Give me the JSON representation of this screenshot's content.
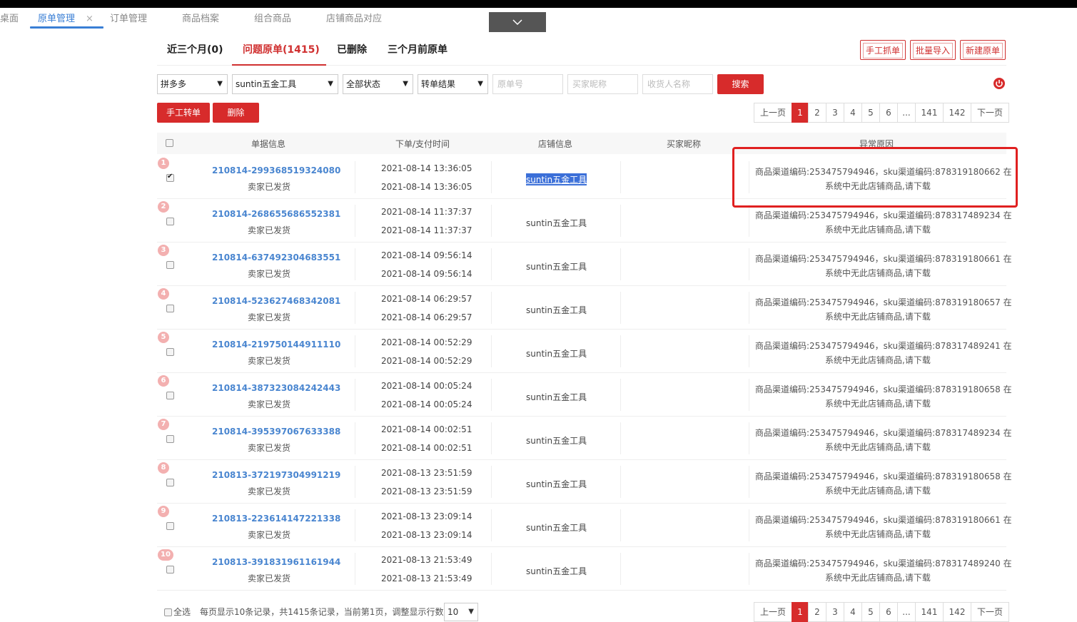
{
  "nav": {
    "tabs": [
      {
        "label": "桌面",
        "active": false
      },
      {
        "label": "原单管理",
        "active": true
      },
      {
        "label": "订单管理",
        "active": false
      },
      {
        "label": "商品档案",
        "active": false
      },
      {
        "label": "组合商品",
        "active": false
      },
      {
        "label": "店铺商品对应",
        "active": false
      }
    ],
    "close_icon": "×"
  },
  "subtabs": [
    "近三个月(0)",
    "问题原单(1415)",
    "已删除",
    "三个月前原单"
  ],
  "actions": {
    "manual_grab": "手工抓单",
    "batch_import": "批量导入",
    "new_order": "新建原单"
  },
  "filters": {
    "platform": "拼多多",
    "shop": "suntin五金工具",
    "status": "全部状态",
    "convert_result": "转单结果",
    "order_no_placeholder": "原单号",
    "buyer_nick_placeholder": "买家昵称",
    "receiver_placeholder": "收货人名称",
    "search_label": "搜索"
  },
  "bulk": {
    "manual_convert": "手工转单",
    "delete": "删除"
  },
  "pagination": {
    "prev": "上一页",
    "pages": [
      "1",
      "2",
      "3",
      "4",
      "5",
      "6",
      "...",
      "141",
      "142"
    ],
    "current": "1",
    "next": "下一页"
  },
  "table": {
    "headers": [
      "单据信息",
      "下单/支付时间",
      "店铺信息",
      "买家昵称",
      "异常原因"
    ],
    "rows": [
      {
        "index": "1",
        "checked": true,
        "order_no": "210814-299368519324080",
        "status": "卖家已发货",
        "order_time": "2021-08-14 13:36:05",
        "pay_time": "2021-08-14 13:36:05",
        "shop": "suntin五金工具",
        "buyer": "",
        "reason_line1": "商品渠道编码:253475794946，sku渠道编码:878319180662 在",
        "reason_line2": "系统中无此店铺商品,请下载"
      },
      {
        "index": "2",
        "checked": false,
        "order_no": "210814-268655686552381",
        "status": "卖家已发货",
        "order_time": "2021-08-14 11:37:37",
        "pay_time": "2021-08-14 11:37:37",
        "shop": "suntin五金工具",
        "buyer": "",
        "reason_line1": "商品渠道编码:253475794946，sku渠道编码:878317489234 在",
        "reason_line2": "系统中无此店铺商品,请下载"
      },
      {
        "index": "3",
        "checked": false,
        "order_no": "210814-637492304683551",
        "status": "卖家已发货",
        "order_time": "2021-08-14 09:56:14",
        "pay_time": "2021-08-14 09:56:14",
        "shop": "suntin五金工具",
        "buyer": "",
        "reason_line1": "商品渠道编码:253475794946，sku渠道编码:878319180661 在",
        "reason_line2": "系统中无此店铺商品,请下载"
      },
      {
        "index": "4",
        "checked": false,
        "order_no": "210814-523627468342081",
        "status": "卖家已发货",
        "order_time": "2021-08-14 06:29:57",
        "pay_time": "2021-08-14 06:29:57",
        "shop": "suntin五金工具",
        "buyer": "",
        "reason_line1": "商品渠道编码:253475794946，sku渠道编码:878319180657 在",
        "reason_line2": "系统中无此店铺商品,请下载"
      },
      {
        "index": "5",
        "checked": false,
        "order_no": "210814-219750144911110",
        "status": "卖家已发货",
        "order_time": "2021-08-14 00:52:29",
        "pay_time": "2021-08-14 00:52:29",
        "shop": "suntin五金工具",
        "buyer": "",
        "reason_line1": "商品渠道编码:253475794946，sku渠道编码:878317489241 在",
        "reason_line2": "系统中无此店铺商品,请下载"
      },
      {
        "index": "6",
        "checked": false,
        "order_no": "210814-387323084242443",
        "status": "卖家已发货",
        "order_time": "2021-08-14 00:05:24",
        "pay_time": "2021-08-14 00:05:24",
        "shop": "suntin五金工具",
        "buyer": "",
        "reason_line1": "商品渠道编码:253475794946，sku渠道编码:878319180658 在",
        "reason_line2": "系统中无此店铺商品,请下载"
      },
      {
        "index": "7",
        "checked": false,
        "order_no": "210814-395397067633388",
        "status": "卖家已发货",
        "order_time": "2021-08-14 00:02:51",
        "pay_time": "2021-08-14 00:02:51",
        "shop": "suntin五金工具",
        "buyer": "",
        "reason_line1": "商品渠道编码:253475794946，sku渠道编码:878317489234 在",
        "reason_line2": "系统中无此店铺商品,请下载"
      },
      {
        "index": "8",
        "checked": false,
        "order_no": "210813-372197304991219",
        "status": "卖家已发货",
        "order_time": "2021-08-13 23:51:59",
        "pay_time": "2021-08-13 23:51:59",
        "shop": "suntin五金工具",
        "buyer": "",
        "reason_line1": "商品渠道编码:253475794946，sku渠道编码:878319180658 在",
        "reason_line2": "系统中无此店铺商品,请下载"
      },
      {
        "index": "9",
        "checked": false,
        "order_no": "210813-223614147221338",
        "status": "卖家已发货",
        "order_time": "2021-08-13 23:09:14",
        "pay_time": "2021-08-13 23:09:14",
        "shop": "suntin五金工具",
        "buyer": "",
        "reason_line1": "商品渠道编码:253475794946，sku渠道编码:878319180661 在",
        "reason_line2": "系统中无此店铺商品,请下载"
      },
      {
        "index": "10",
        "checked": false,
        "order_no": "210813-391831961161944",
        "status": "卖家已发货",
        "order_time": "2021-08-13 21:53:49",
        "pay_time": "2021-08-13 21:53:49",
        "shop": "suntin五金工具",
        "buyer": "",
        "reason_line1": "商品渠道编码:253475794946，sku渠道编码:878317489240 在",
        "reason_line2": "系统中无此店铺商品,请下载"
      }
    ]
  },
  "footer": {
    "select_all": "全选",
    "summary": "每页显示10条记录，共1415条记录，当前第1页，调整显示行数",
    "rows_per_page": "10"
  },
  "colors": {
    "accent_red": "#d72b2b",
    "link_blue": "#4a86d0",
    "nav_active": "#3a7fd5",
    "highlight_box": "#e02020"
  },
  "icons": [
    "close-icon",
    "chevron-down-icon",
    "power-icon",
    "caret-down-icon",
    "checkbox-icon"
  ]
}
